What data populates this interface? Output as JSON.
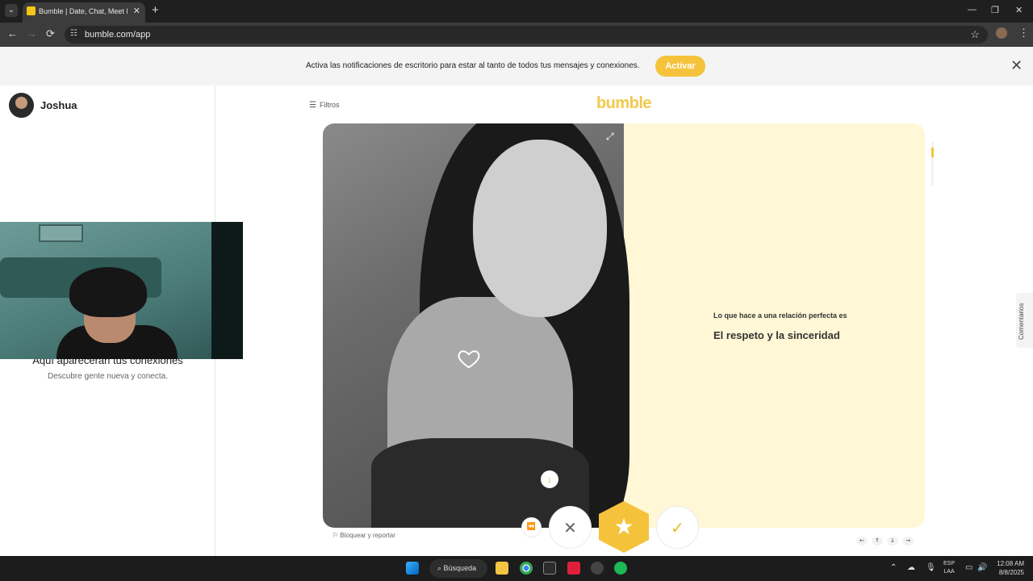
{
  "browser": {
    "tab_title": "Bumble | Date, Chat, Meet New",
    "url": "bumble.com/app",
    "tab_list_icon": "chevron-down-icon",
    "new_tab_symbol": "+",
    "back_symbol": "←",
    "forward_symbol": "→",
    "reload_symbol": "⟳",
    "site_info_symbol": "☷",
    "bookmark_symbol": "☆",
    "menu_symbol": "⋮",
    "close_tab_symbol": "✕",
    "minimize_symbol": "—",
    "restore_symbol": "❐",
    "close_window_symbol": "✕"
  },
  "banner": {
    "message": "Activa las notificaciones de escritorio para estar al tanto de todos tus mensajes y conexiones.",
    "button_label": "Activar",
    "close_symbol": "✕"
  },
  "sidebar": {
    "user_name": "Joshua",
    "empty_title": "Aquí aparecerán tus conexiones",
    "empty_subtitle": "Descubre gente nueva y conecta."
  },
  "main": {
    "filters_label": "Filtros",
    "filters_icon": "sliders-icon",
    "logo": "bumble",
    "prompt_question": "Lo que hace a una relación perfecta es",
    "prompt_answer": "El respeto y la sinceridad",
    "comments_label": "Comentarios",
    "report_label": "Bloquear y reportar",
    "report_icon": "flag-icon"
  },
  "actions": {
    "undo_symbol": "⏪",
    "pass_symbol": "✕",
    "superswipe_symbol": "★",
    "like_symbol": "✓",
    "down_symbol": "↓"
  },
  "keyboard_hints": [
    "←",
    "↑",
    "↓",
    "→"
  ],
  "taskbar": {
    "search_label": "Búsqueda",
    "lang_top": "ESP",
    "lang_bottom": "LAA",
    "time": "12:08 AM",
    "date": "8/8/2025"
  },
  "colors": {
    "brand_yellow": "#f5c33b",
    "card_background": "#fff7d6"
  }
}
